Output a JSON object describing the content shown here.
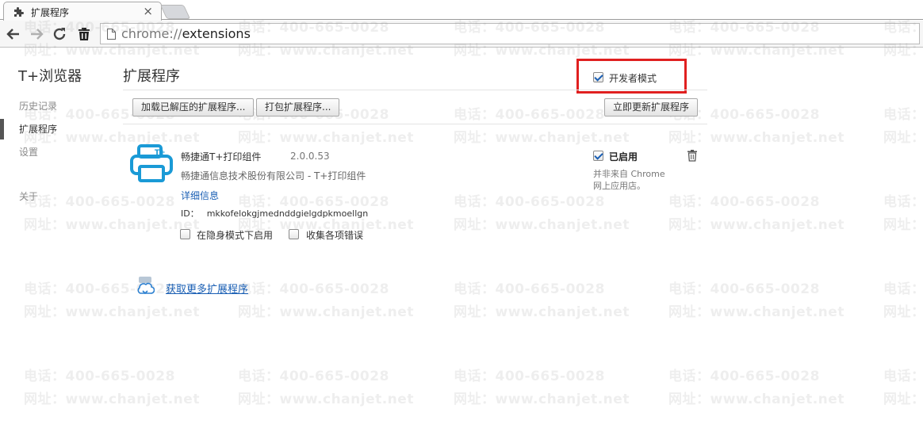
{
  "tab": {
    "title": "扩展程序",
    "close": "×",
    "icon": "puzzle-icon"
  },
  "toolbar": {
    "back_icon": "arrow-left-icon",
    "forward_icon": "arrow-right-icon",
    "reload_icon": "reload-icon",
    "trash_icon": "trash-icon",
    "url_scheme": "chrome://",
    "url_path": "extensions"
  },
  "sidebar": {
    "title": "T+浏览器",
    "items": [
      {
        "label": "历史记录"
      },
      {
        "label": "扩展程序"
      },
      {
        "label": "设置"
      },
      {
        "label": "关于"
      }
    ]
  },
  "main": {
    "title": "扩展程序",
    "developer_mode_label": "开发者模式",
    "developer_mode_checked": true,
    "load_unpacked_label": "加载已解压的扩展程序...",
    "pack_label": "打包扩展程序...",
    "update_label": "立即更新扩展程序"
  },
  "extension": {
    "name": "畅捷通T+打印组件",
    "version": "2.0.0.53",
    "description": "畅捷通信息技术股份有限公司 - T+打印组件",
    "details_label": "详细信息",
    "id_label": "ID：",
    "id_value": "mkkofelokgjmednddgielgdpkmoellgn",
    "incognito_label": "在隐身模式下启用",
    "collect_errors_label": "收集各项错误",
    "enabled_label": "已启用",
    "not_from_store_line1": "并非来自 Chrome",
    "not_from_store_line2": "网上应用店。",
    "accent": "#1a9ad6"
  },
  "get_more_label": "获取更多扩展程序",
  "watermark": {
    "phone": "电话：400-665-0028",
    "site": "网址：www.chanjet.net"
  }
}
